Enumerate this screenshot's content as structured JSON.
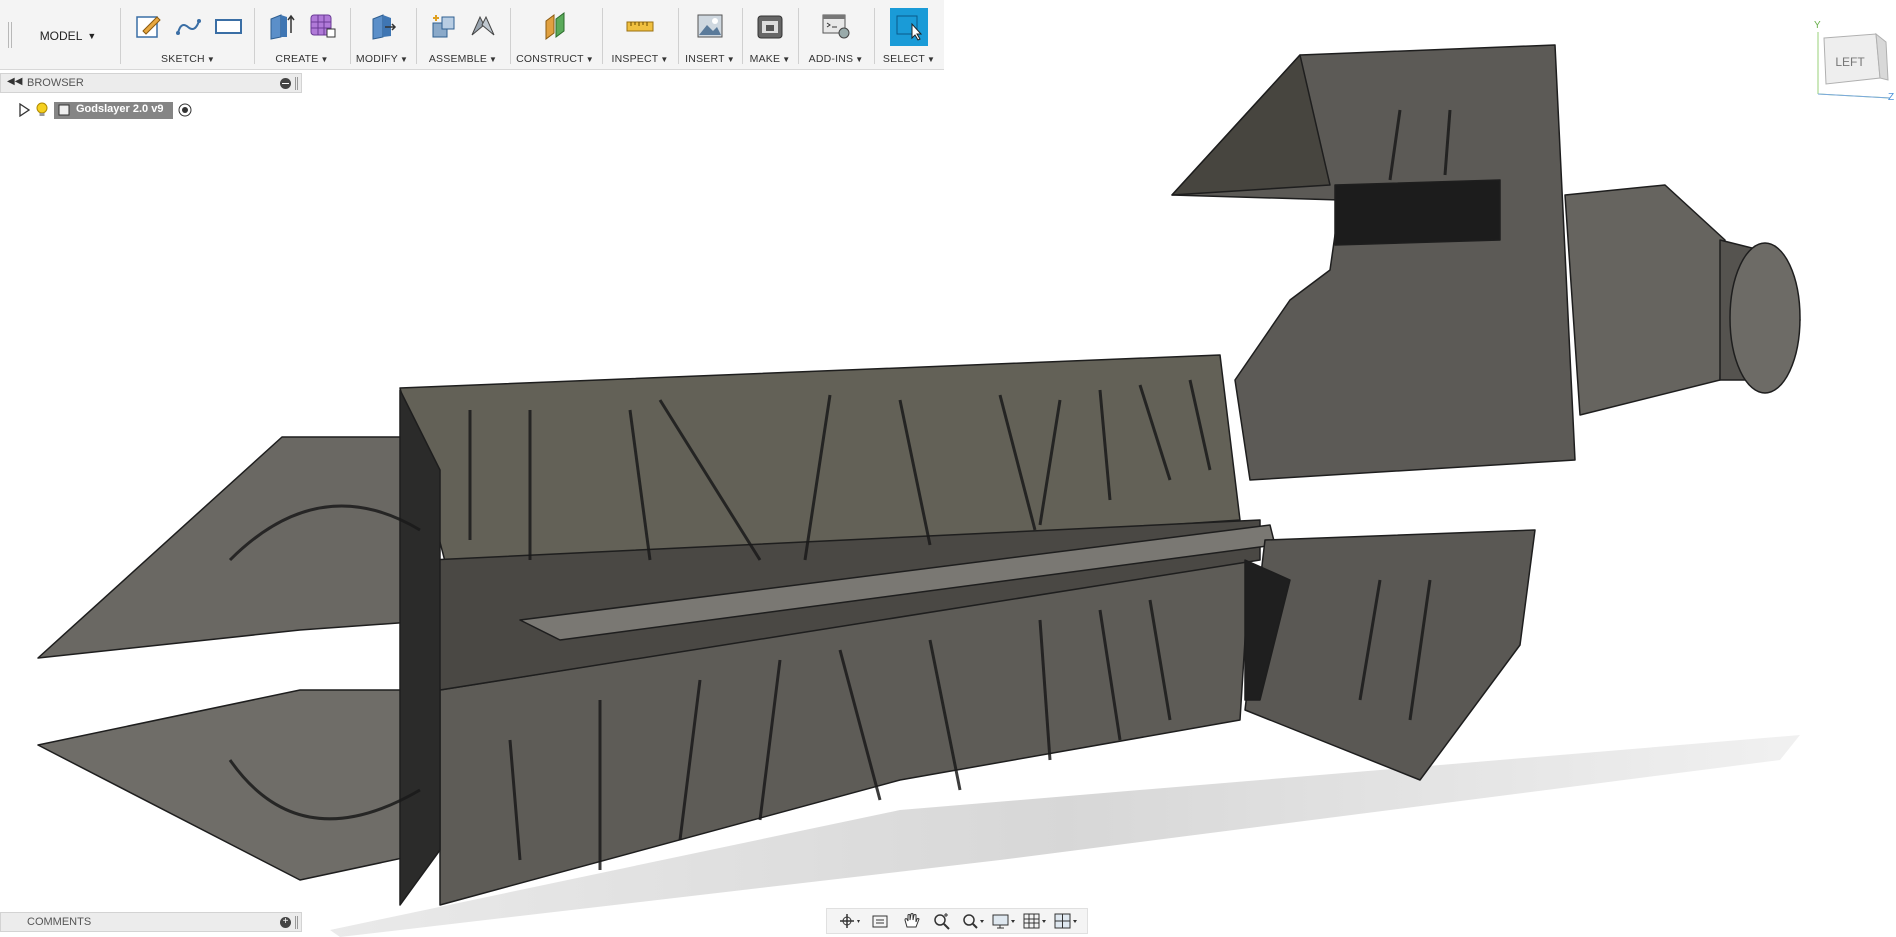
{
  "toolbar": {
    "model_label": "MODEL",
    "groups": [
      {
        "label": "SKETCH"
      },
      {
        "label": "CREATE"
      },
      {
        "label": "MODIFY"
      },
      {
        "label": "ASSEMBLE"
      },
      {
        "label": "CONSTRUCT"
      },
      {
        "label": "INSPECT"
      },
      {
        "label": "INSERT"
      },
      {
        "label": "MAKE"
      },
      {
        "label": "ADD-INS"
      },
      {
        "label": "SELECT"
      }
    ]
  },
  "browser": {
    "title": "BROWSER",
    "root_node": "Godslayer 2.0 v9"
  },
  "comments": {
    "title": "COMMENTS"
  },
  "viewcube": {
    "face": "LEFT",
    "axis_y": "Y",
    "axis_z": "Z"
  },
  "colors": {
    "accent": "#1a9bd7",
    "model": "#5a5854"
  }
}
